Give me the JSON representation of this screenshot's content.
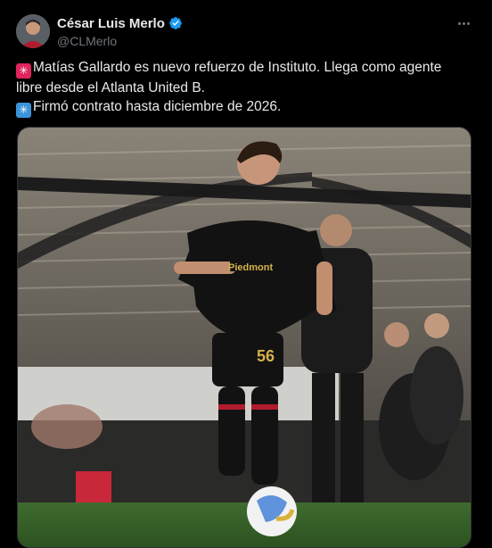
{
  "author": {
    "display_name": "César Luis Merlo",
    "handle": "@CLMerlo",
    "verified": true,
    "verified_color": "#1d9bf0",
    "avatar_icon": "profile-photo"
  },
  "menu": {
    "icon": "more-horizontal-icon"
  },
  "tweet": {
    "line1": "Matías Gallardo es nuevo refuerzo de Instituto. Llega como agente",
    "line2": "libre desde el Atlanta United B.",
    "line3": "Firmó contrato hasta diciembre de 2026.",
    "emoji1": "✳",
    "emoji2": "✳"
  },
  "media": {
    "jersey_sponsor": "Piedmont",
    "jersey_number": "56"
  },
  "colors": {
    "background": "#000000",
    "text": "#e7e9ea",
    "secondary": "#71767b",
    "accent": "#1d9bf0"
  }
}
